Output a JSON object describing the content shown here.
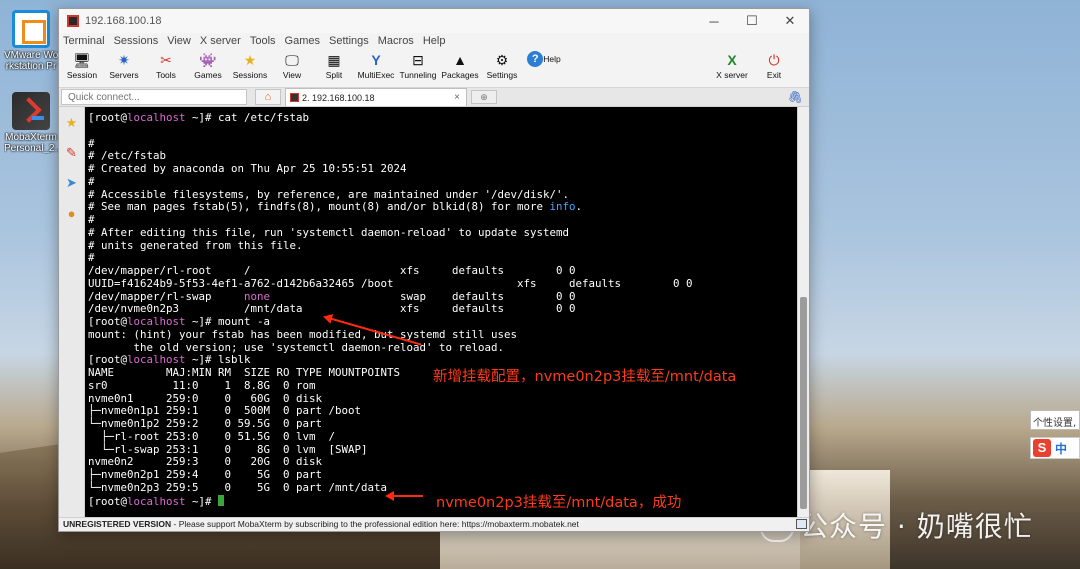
{
  "desktop": {
    "icons": [
      {
        "label_line1": "VMware Wo",
        "label_line2": "rkstation Pr"
      },
      {
        "label_line1": "MobaXterm",
        "label_line2": "Personal_2..."
      }
    ],
    "watermark": "公众号 · 奶嘴很忙",
    "ime": {
      "tooltip": "个性设置,",
      "mode": "中",
      "logo": "S"
    }
  },
  "window": {
    "title": "192.168.100.18",
    "controls": {
      "minimize": "─",
      "maximize": "☐",
      "close": "✕"
    },
    "menu": [
      "Terminal",
      "Sessions",
      "View",
      "X server",
      "Tools",
      "Games",
      "Settings",
      "Macros",
      "Help"
    ],
    "toolbar": [
      {
        "label": "Session",
        "icon": "session-icon",
        "glyph": "🖥"
      },
      {
        "label": "Servers",
        "icon": "servers-icon",
        "glyph": "✷"
      },
      {
        "label": "Tools",
        "icon": "tools-icon",
        "glyph": "✂"
      },
      {
        "label": "Games",
        "icon": "games-icon",
        "glyph": "👾"
      },
      {
        "label": "Sessions",
        "icon": "star-icon",
        "glyph": "★"
      },
      {
        "label": "View",
        "icon": "view-icon",
        "glyph": "🖵"
      },
      {
        "label": "Split",
        "icon": "split-icon",
        "glyph": "▦"
      },
      {
        "label": "MultiExec",
        "icon": "multiexec-icon",
        "glyph": "Y"
      },
      {
        "label": "Tunneling",
        "icon": "tunneling-icon",
        "glyph": "⊟"
      },
      {
        "label": "Packages",
        "icon": "packages-icon",
        "glyph": "▲"
      },
      {
        "label": "Settings",
        "icon": "settings-icon",
        "glyph": "⚙"
      },
      {
        "label": "Help",
        "icon": "help-icon",
        "glyph": "?"
      }
    ],
    "toolbar_right": [
      {
        "label": "X server",
        "icon": "x-server-icon",
        "glyph": "X"
      },
      {
        "label": "Exit",
        "icon": "exit-icon",
        "glyph": "⏻"
      }
    ],
    "quick_connect": {
      "placeholder": "Quick connect..."
    },
    "tab": {
      "label": "2. 192.168.100.18",
      "close": "×"
    },
    "status": {
      "unregistered": "UNREGISTERED VERSION",
      "message": "  -  Please support MobaXterm by subscribing to the professional edition here:  https://mobaxterm.mobatek.net"
    },
    "colors": {
      "prompt_user": "#d86bd0",
      "annotation": "#ff3a1a",
      "info": "#4aa3ff"
    }
  },
  "terminal": {
    "prompt": {
      "open": "[root@",
      "host": "localhost",
      "close": " ~]# "
    },
    "lines": [
      {
        "type": "prompt",
        "cmd": "cat /etc/fstab"
      },
      {
        "type": "text",
        "text": ""
      },
      {
        "type": "text",
        "text": "#"
      },
      {
        "type": "text",
        "text": "# /etc/fstab"
      },
      {
        "type": "text",
        "text": "# Created by anaconda on Thu Apr 25 10:55:51 2024"
      },
      {
        "type": "text",
        "text": "#"
      },
      {
        "type": "info",
        "pre": "# Accessible filesystems, by reference, are maintained under '/dev/disk/'.",
        "hl": "",
        "post": ""
      },
      {
        "type": "info",
        "pre": "# See man pages fstab(5), findfs(8), mount(8) and/or blkid(8) for more ",
        "hl": "info",
        "post": "."
      },
      {
        "type": "text",
        "text": "#"
      },
      {
        "type": "text",
        "text": "# After editing this file, run 'systemctl daemon-reload' to update systemd"
      },
      {
        "type": "text",
        "text": "# units generated from this file."
      },
      {
        "type": "text",
        "text": "#"
      },
      {
        "type": "text",
        "text": "/dev/mapper/rl-root     /                       xfs     defaults        0 0"
      },
      {
        "type": "text",
        "text": "UUID=f41624b9-5f53-4ef1-a762-d142b6a32465 /boot                   xfs     defaults        0 0"
      },
      {
        "type": "none",
        "pre": "/dev/mapper/rl-swap     ",
        "hl": "none",
        "post": "                    swap    defaults        0 0"
      },
      {
        "type": "text",
        "text": "/dev/nvme0n2p3          /mnt/data               xfs     defaults        0 0"
      },
      {
        "type": "prompt",
        "cmd": "mount -a"
      },
      {
        "type": "text",
        "text": "mount: (hint) your fstab has been modified, but systemd still uses"
      },
      {
        "type": "text",
        "text": "       the old version; use 'systemctl daemon-reload' to reload."
      },
      {
        "type": "prompt",
        "cmd": "lsblk"
      },
      {
        "type": "text",
        "text": "NAME        MAJ:MIN RM  SIZE RO TYPE MOUNTPOINTS"
      },
      {
        "type": "text",
        "text": "sr0          11:0    1  8.8G  0 rom"
      },
      {
        "type": "text",
        "text": "nvme0n1     259:0    0   60G  0 disk"
      },
      {
        "type": "text",
        "text": "├─nvme0n1p1 259:1    0  500M  0 part /boot"
      },
      {
        "type": "text",
        "text": "└─nvme0n1p2 259:2    0 59.5G  0 part"
      },
      {
        "type": "text",
        "text": "  ├─rl-root 253:0    0 51.5G  0 lvm  /"
      },
      {
        "type": "text",
        "text": "  └─rl-swap 253:1    0    8G  0 lvm  [SWAP]"
      },
      {
        "type": "text",
        "text": "nvme0n2     259:3    0   20G  0 disk"
      },
      {
        "type": "text",
        "text": "├─nvme0n2p1 259:4    0    5G  0 part"
      },
      {
        "type": "text",
        "text": "└─nvme0n2p3 259:5    0    5G  0 part /mnt/data"
      },
      {
        "type": "cursor",
        "cmd": ""
      }
    ],
    "annotations": {
      "first": "新增挂载配置，nvme0n2p3挂载至/mnt/data",
      "second": "nvme0n2p3挂载至/mnt/data，成功"
    }
  }
}
